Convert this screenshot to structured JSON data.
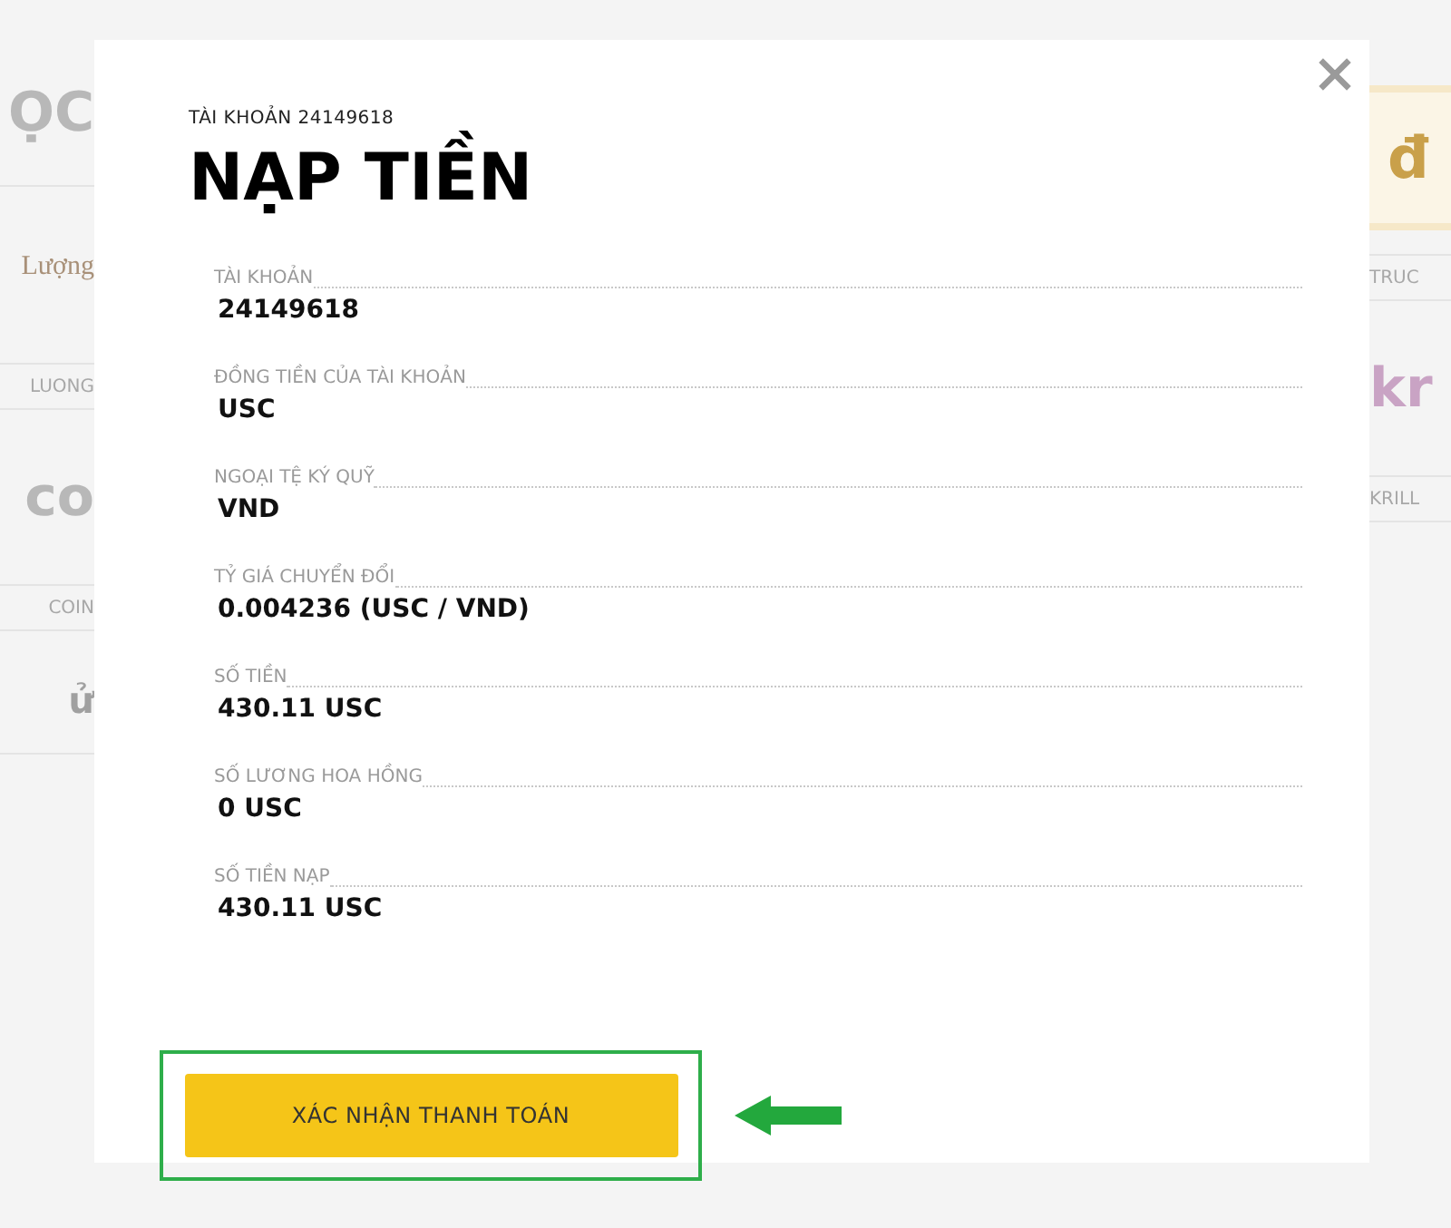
{
  "background": {
    "left": [
      {
        "kind": "logo",
        "text": "ỌC"
      },
      {
        "kind": "brand",
        "text": "Lượng"
      },
      {
        "kind": "label",
        "text": "LUONG"
      },
      {
        "kind": "logo",
        "text": "co"
      },
      {
        "kind": "label",
        "text": "COIN"
      },
      {
        "kind": "heading",
        "text": "ử"
      }
    ],
    "right": [
      {
        "kind": "emblem",
        "text": "đ"
      },
      {
        "kind": "label",
        "text": "TRUC"
      },
      {
        "kind": "logo",
        "text": "kr"
      },
      {
        "kind": "label",
        "text": "KRILL"
      }
    ]
  },
  "modal": {
    "subtitle": "TÀI KHOẢN 24149618",
    "title": "NẠP TIỀN",
    "rows": [
      {
        "label": "TÀI KHOẢN",
        "value": "24149618"
      },
      {
        "label": "ĐỒNG TIỀN CỦA TÀI KHOẢN",
        "value": "USC"
      },
      {
        "label": "NGOẠI TỆ KÝ QUỸ",
        "value": "VND"
      },
      {
        "label": "TỶ GIÁ CHUYỂN ĐỔI",
        "value": "0.004236 (USC / VND)"
      },
      {
        "label": "SỐ TIỀN",
        "value": "430.11 USC"
      },
      {
        "label": "SỐ LƯƠNG HOA HỒNG",
        "value": "0 USC"
      },
      {
        "label": "SỐ TIỀN NẠP",
        "value": "430.11 USC"
      }
    ],
    "confirm_button": "XÁC NHẬN THANH TOÁN"
  }
}
